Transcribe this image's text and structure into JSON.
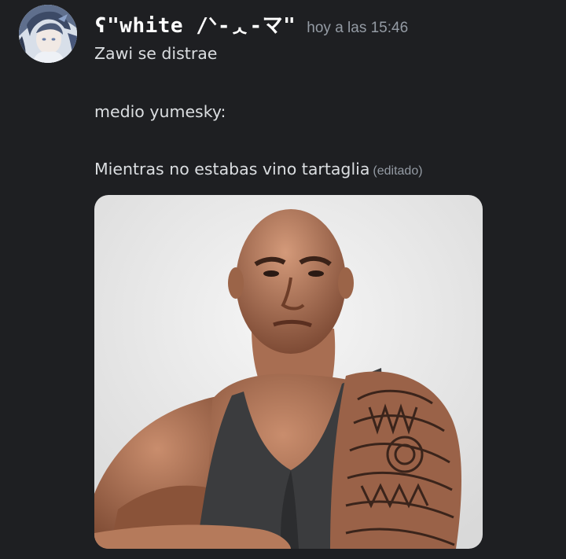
{
  "message": {
    "author": {
      "username": "ʕ\"white /ᐠ-ᆺ-マ\"",
      "avatar_icon": "user-avatar-icon"
    },
    "timestamp": "hoy a las 15:46",
    "lines": [
      "Zawi se distrae",
      "medio yumesky:",
      "Mientras no estabas vino tartaglia"
    ],
    "edited_label": "(editado)",
    "attachment": {
      "icon": "image-attachment-icon"
    }
  },
  "colors": {
    "background": "#1e1f22",
    "username": "#ffffff",
    "text": "#dbdee1",
    "muted": "#949ba4"
  }
}
